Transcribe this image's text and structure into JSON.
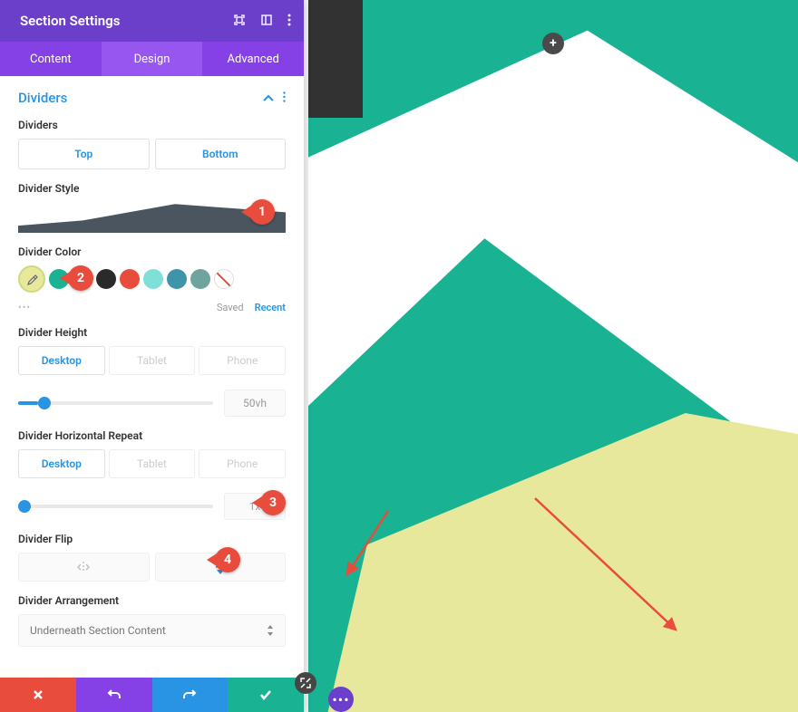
{
  "header": {
    "title": "Section Settings"
  },
  "tabs": {
    "content": "Content",
    "design": "Design",
    "advanced": "Advanced"
  },
  "group": {
    "title": "Dividers"
  },
  "labels": {
    "dividers": "Dividers",
    "style": "Divider Style",
    "color": "Divider Color",
    "height": "Divider Height",
    "repeat": "Divider Horizontal Repeat",
    "flip": "Divider Flip",
    "arrangement": "Divider Arrangement"
  },
  "dividers_tabs": {
    "top": "Top",
    "bottom": "Bottom"
  },
  "colors": {
    "picker": "#e8e89d",
    "swatches": [
      "#19b293",
      "#ffffff",
      "#2a2a2a",
      "#e74c3c",
      "#7ee0d6",
      "#3e94a8",
      "#6fa39e"
    ],
    "saved": "Saved",
    "recent": "Recent"
  },
  "responsive": {
    "desktop": "Desktop",
    "tablet": "Tablet",
    "phone": "Phone"
  },
  "height": {
    "value": "50vh",
    "percent": 10
  },
  "repeat": {
    "value": "1x",
    "percent": 0
  },
  "arrangement": {
    "value": "Underneath Section Content"
  },
  "callouts": {
    "c1": "1",
    "c2": "2",
    "c3": "3",
    "c4": "4"
  },
  "canvas": {
    "accent": "#19b293",
    "overlay": "#e8e89d"
  }
}
